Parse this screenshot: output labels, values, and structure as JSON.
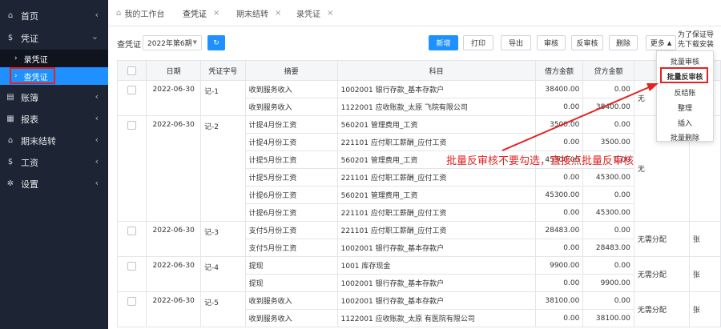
{
  "sidebar": {
    "items": [
      {
        "label": "首页",
        "icon": "home-icon"
      },
      {
        "label": "凭证",
        "icon": "dollar-icon"
      },
      {
        "label": "账簿",
        "icon": "book-icon"
      },
      {
        "label": "报表",
        "icon": "report-icon"
      },
      {
        "label": "期末结转",
        "icon": "home-icon"
      },
      {
        "label": "工资",
        "icon": "dollar-icon"
      },
      {
        "label": "设置",
        "icon": "settings-icon"
      }
    ],
    "subitems": [
      {
        "label": "录凭证"
      },
      {
        "label": "查凭证"
      }
    ]
  },
  "tabs": [
    {
      "label": "我的工作台"
    },
    {
      "label": "查凭证"
    },
    {
      "label": "期末结转"
    },
    {
      "label": "录凭证"
    }
  ],
  "toolbar": {
    "period_label": "查凭证",
    "period_value": "2022年第6期",
    "refresh_icon": "refresh-icon",
    "buttons": [
      "新增",
      "打印",
      "导出",
      "审核",
      "反审核",
      "删除",
      "更多"
    ]
  },
  "dropdown": [
    "批量审核",
    "批量反审核",
    "反结账",
    "整理",
    "插入",
    "批量删除"
  ],
  "side_note": [
    "为了保证导",
    "先下载安装"
  ],
  "annotation": "批量反审核不要勾选，直接点批量反审核",
  "table": {
    "headers": [
      "日期",
      "凭证字号",
      "摘要",
      "科目",
      "借方金额",
      "贷方金额",
      "",
      ""
    ],
    "vouchers": [
      {
        "date": "2022-06-30",
        "no": "记-1",
        "status": "无",
        "extra": "",
        "rows": [
          {
            "summary": "收到服务收入",
            "account": "1002001 银行存款_基本存款户",
            "debit": "38400.00",
            "credit": "0.00"
          },
          {
            "summary": "收到服务收入",
            "account": "1122001 应收账款_太原              飞院有限公司",
            "debit": "0.00",
            "credit": "38400.00"
          }
        ]
      },
      {
        "date": "2022-06-30",
        "no": "记-2",
        "status": "无",
        "extra": "",
        "rows": [
          {
            "summary": "计提4月份工资",
            "account": "560201 管理费用_工资",
            "debit": "3500.00",
            "credit": "0.00"
          },
          {
            "summary": "计提4月份工资",
            "account": "221101 应付职工薪酬_应付工资",
            "debit": "0.00",
            "credit": "3500.00"
          },
          {
            "summary": "计提5月份工资",
            "account": "560201 管理费用_工资",
            "debit": "45300.00",
            "credit": "0.00"
          },
          {
            "summary": "计提5月份工资",
            "account": "221101 应付职工薪酬_应付工资",
            "debit": "0.00",
            "credit": "45300.00"
          },
          {
            "summary": "计提6月份工资",
            "account": "560201 管理费用_工资",
            "debit": "45300.00",
            "credit": "0.00"
          },
          {
            "summary": "计提6月份工资",
            "account": "221101 应付职工薪酬_应付工资",
            "debit": "0.00",
            "credit": "45300.00"
          }
        ]
      },
      {
        "date": "2022-06-30",
        "no": "记-3",
        "status": "无需分配",
        "extra": "张",
        "rows": [
          {
            "summary": "支付5月份工资",
            "account": "221101 应付职工薪酬_应付工资",
            "debit": "28483.00",
            "credit": "0.00"
          },
          {
            "summary": "支付5月份工资",
            "account": "1002001 银行存款_基本存款户",
            "debit": "0.00",
            "credit": "28483.00"
          }
        ]
      },
      {
        "date": "2022-06-30",
        "no": "记-4",
        "status": "无需分配",
        "extra": "张",
        "rows": [
          {
            "summary": "提现",
            "account": "1001 库存现金",
            "debit": "9900.00",
            "credit": "0.00"
          },
          {
            "summary": "提现",
            "account": "1002001 银行存款_基本存款户",
            "debit": "0.00",
            "credit": "9900.00"
          }
        ]
      },
      {
        "date": "2022-06-30",
        "no": "记-5",
        "status": "无需分配",
        "extra": "张",
        "rows": [
          {
            "summary": "收到服务收入",
            "account": "1002001 银行存款_基本存款户",
            "debit": "38100.00",
            "credit": "0.00"
          },
          {
            "summary": "收到服务收入",
            "account": "1122001 应收账款_太原           有医院有限公司",
            "debit": "0.00",
            "credit": "38100.00"
          }
        ]
      }
    ]
  },
  "colors": {
    "sidebar_bg": "#1d2433",
    "accent": "#1e90ff",
    "annotation": "#e52222"
  }
}
